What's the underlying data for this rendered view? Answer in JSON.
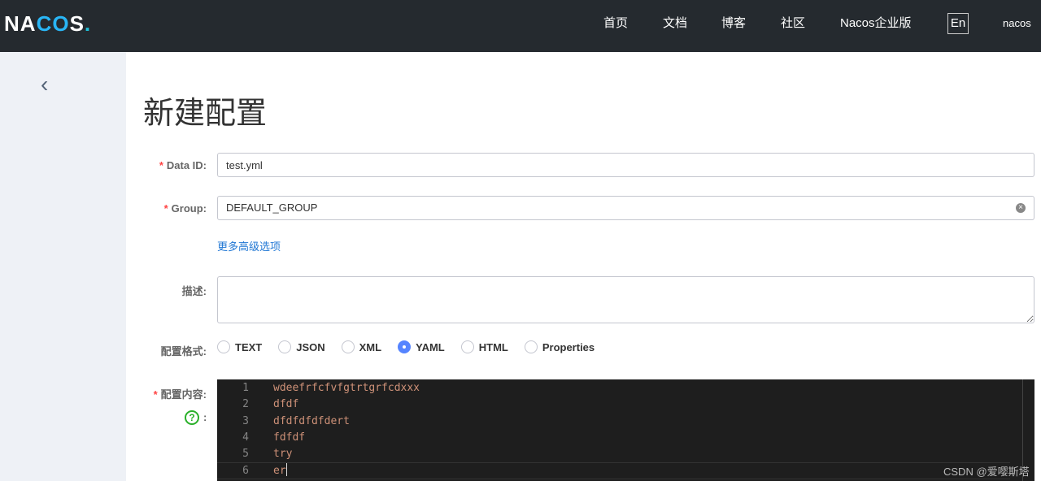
{
  "header": {
    "logo": "NACOS.",
    "nav": [
      "首页",
      "文档",
      "博客",
      "社区",
      "Nacos企业版"
    ],
    "lang": "En",
    "user": "nacos"
  },
  "page": {
    "title": "新建配置"
  },
  "form": {
    "data_id": {
      "label": "Data ID:",
      "value": "test.yml"
    },
    "group": {
      "label": "Group:",
      "value": "DEFAULT_GROUP"
    },
    "more_options": "更多高级选项",
    "description": {
      "label": "描述:",
      "value": ""
    },
    "format": {
      "label": "配置格式:",
      "options": [
        "TEXT",
        "JSON",
        "XML",
        "YAML",
        "HTML",
        "Properties"
      ],
      "selected": "YAML"
    },
    "content": {
      "label": "配置内容:",
      "help_suffix": ":",
      "lines": [
        "wdeefrfcfvfgtrtgrfcdxxx",
        "dfdf",
        "dfdfdfdfdert",
        "fdfdf",
        "try",
        "er"
      ]
    }
  },
  "watermark": "CSDN @爱嘤斯塔"
}
